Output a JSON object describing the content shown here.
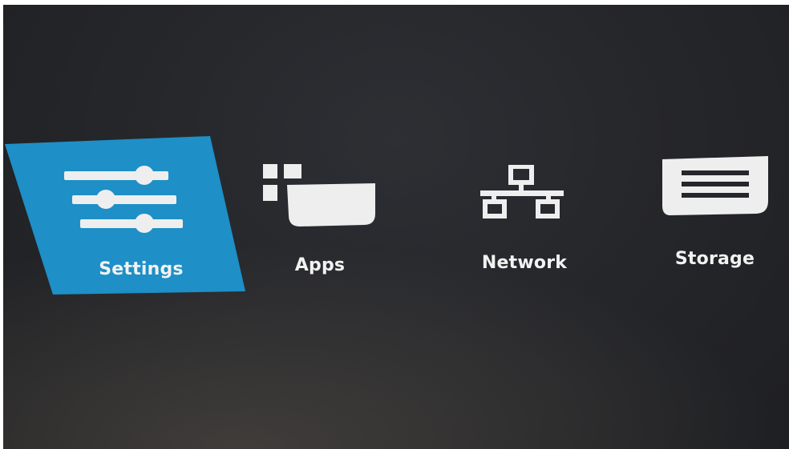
{
  "menu": {
    "items": [
      {
        "label": "Settings",
        "icon": "sliders-icon",
        "selected": true
      },
      {
        "label": "Apps",
        "icon": "apps-icon",
        "selected": false
      },
      {
        "label": "Network",
        "icon": "network-icon",
        "selected": false
      },
      {
        "label": "Storage",
        "icon": "storage-icon",
        "selected": false
      }
    ]
  },
  "colors": {
    "accent": "#1e8fc7",
    "background": "#26272b",
    "text": "#f2f2f2"
  }
}
